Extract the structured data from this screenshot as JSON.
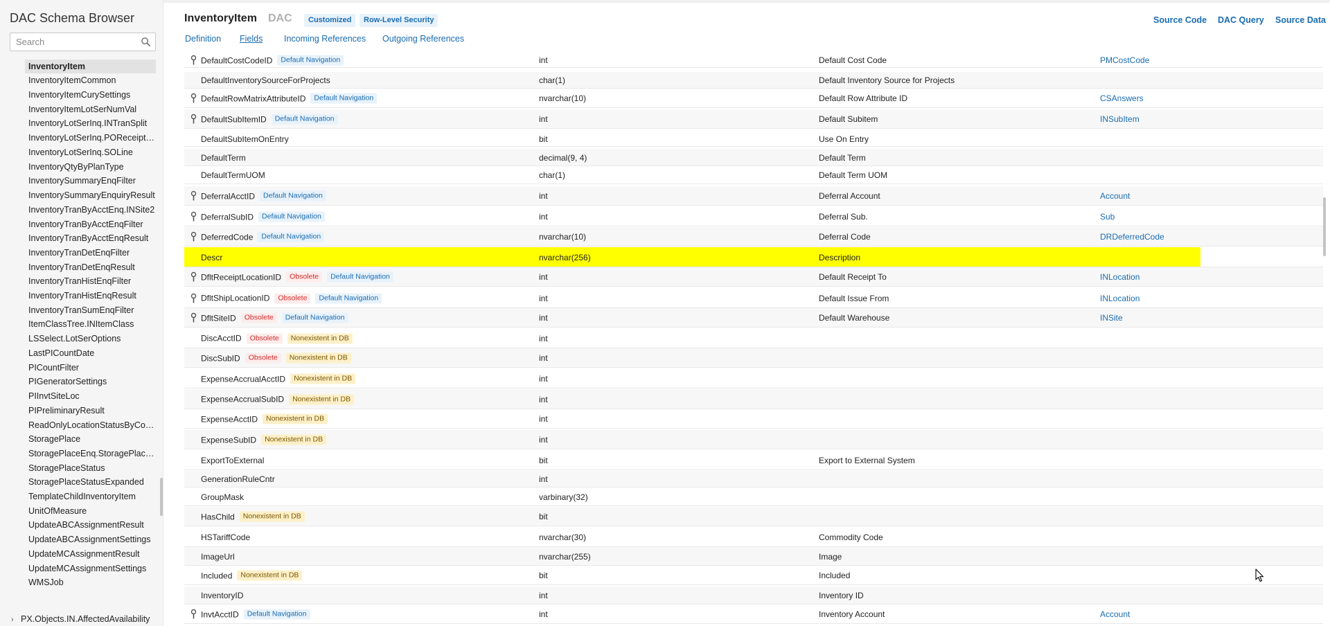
{
  "sidebar": {
    "title": "DAC Schema Browser",
    "search_placeholder": "Search",
    "items": [
      "InventoryItem",
      "InventoryItemCommon",
      "InventoryItemCurySettings",
      "InventoryItemLotSerNumVal",
      "InventoryLotSerInq.INTranSplit",
      "InventoryLotSerInq.POReceiptLine",
      "InventoryLotSerInq.SOLine",
      "InventoryQtyByPlanType",
      "InventorySummaryEnqFilter",
      "InventorySummaryEnquiryResult",
      "InventoryTranByAcctEnq.INSite2",
      "InventoryTranByAcctEnqFilter",
      "InventoryTranByAcctEnqResult",
      "InventoryTranDetEnqFilter",
      "InventoryTranDetEnqResult",
      "InventoryTranHistEnqFilter",
      "InventoryTranHistEnqResult",
      "InventoryTranSumEnqFilter",
      "ItemClassTree.INItemClass",
      "LSSelect.LotSerOptions",
      "LastPICountDate",
      "PICountFilter",
      "PIGeneratorSettings",
      "PIInvtSiteLoc",
      "PIPreliminaryResult",
      "ReadOnlyLocationStatusByCost...",
      "StoragePlace",
      "StoragePlaceEnq.StoragePlaceF...",
      "StoragePlaceStatus",
      "StoragePlaceStatusExpanded",
      "TemplateChildInventoryItem",
      "UnitOfMeasure",
      "UpdateABCAssignmentResult",
      "UpdateABCAssignmentSettings",
      "UpdateMCAssignmentResult",
      "UpdateMCAssignmentSettings",
      "WMSJob"
    ],
    "selected_index": 0,
    "group_label": "PX.Objects.IN.AffectedAvailability"
  },
  "header": {
    "title": "InventoryItem",
    "kind": "DAC",
    "badges": [
      "Customized",
      "Row-Level Security"
    ],
    "links": [
      "Source Code",
      "DAC Query",
      "Source Data"
    ],
    "tabs": [
      "Definition",
      "Fields",
      "Incoming References",
      "Outgoing References"
    ],
    "active_tab": "Fields"
  },
  "badge_labels": {
    "nav": "Default Navigation",
    "obs": "Obsolete",
    "nex": "Nonexistent in DB"
  },
  "fields": [
    {
      "name": "DefaultCostCodeID",
      "key": true,
      "badges": [
        "nav"
      ],
      "type": "int",
      "display": "Default Cost Code",
      "ref": "PMCostCode"
    },
    {
      "name": "DefaultInventorySourceForProjects",
      "key": false,
      "badges": [],
      "type": "char(1)",
      "display": "Default Inventory Source for Projects",
      "ref": ""
    },
    {
      "name": "DefaultRowMatrixAttributeID",
      "key": true,
      "badges": [
        "nav"
      ],
      "type": "nvarchar(10)",
      "display": "Default Row Attribute ID",
      "ref": "CSAnswers"
    },
    {
      "name": "DefaultSubItemID",
      "key": true,
      "badges": [
        "nav"
      ],
      "type": "int",
      "display": "Default Subitem",
      "ref": "INSubItem"
    },
    {
      "name": "DefaultSubItemOnEntry",
      "key": false,
      "badges": [],
      "type": "bit",
      "display": "Use On Entry",
      "ref": ""
    },
    {
      "name": "DefaultTerm",
      "key": false,
      "badges": [],
      "type": "decimal(9, 4)",
      "display": "Default Term",
      "ref": ""
    },
    {
      "name": "DefaultTermUOM",
      "key": false,
      "badges": [],
      "type": "char(1)",
      "display": "Default Term UOM",
      "ref": ""
    },
    {
      "name": "DeferralAcctID",
      "key": true,
      "badges": [
        "nav"
      ],
      "type": "int",
      "display": "Deferral Account",
      "ref": "Account"
    },
    {
      "name": "DeferralSubID",
      "key": true,
      "badges": [
        "nav"
      ],
      "type": "int",
      "display": "Deferral Sub.",
      "ref": "Sub"
    },
    {
      "name": "DeferredCode",
      "key": true,
      "badges": [
        "nav"
      ],
      "type": "nvarchar(10)",
      "display": "Deferral Code",
      "ref": "DRDeferredCode"
    },
    {
      "name": "Descr",
      "key": false,
      "badges": [],
      "type": "nvarchar(256)",
      "display": "Description",
      "ref": "",
      "highlight": true
    },
    {
      "name": "DfltReceiptLocationID",
      "key": true,
      "badges": [
        "obs",
        "nav"
      ],
      "type": "int",
      "display": "Default Receipt To",
      "ref": "INLocation"
    },
    {
      "name": "DfltShipLocationID",
      "key": true,
      "badges": [
        "obs",
        "nav"
      ],
      "type": "int",
      "display": "Default Issue From",
      "ref": "INLocation"
    },
    {
      "name": "DfltSiteID",
      "key": true,
      "badges": [
        "obs",
        "nav"
      ],
      "type": "int",
      "display": "Default Warehouse",
      "ref": "INSite"
    },
    {
      "name": "DiscAcctID",
      "key": false,
      "badges": [
        "obs",
        "nex"
      ],
      "type": "int",
      "display": "",
      "ref": ""
    },
    {
      "name": "DiscSubID",
      "key": false,
      "badges": [
        "obs",
        "nex"
      ],
      "type": "int",
      "display": "",
      "ref": ""
    },
    {
      "name": "ExpenseAccrualAcctID",
      "key": false,
      "badges": [
        "nex"
      ],
      "type": "int",
      "display": "",
      "ref": ""
    },
    {
      "name": "ExpenseAccrualSubID",
      "key": false,
      "badges": [
        "nex"
      ],
      "type": "int",
      "display": "",
      "ref": ""
    },
    {
      "name": "ExpenseAcctID",
      "key": false,
      "badges": [
        "nex"
      ],
      "type": "int",
      "display": "",
      "ref": ""
    },
    {
      "name": "ExpenseSubID",
      "key": false,
      "badges": [
        "nex"
      ],
      "type": "int",
      "display": "",
      "ref": ""
    },
    {
      "name": "ExportToExternal",
      "key": false,
      "badges": [],
      "type": "bit",
      "display": "Export to External System",
      "ref": ""
    },
    {
      "name": "GenerationRuleCntr",
      "key": false,
      "badges": [],
      "type": "int",
      "display": "",
      "ref": ""
    },
    {
      "name": "GroupMask",
      "key": false,
      "badges": [],
      "type": "varbinary(32)",
      "display": "",
      "ref": ""
    },
    {
      "name": "HasChild",
      "key": false,
      "badges": [
        "nex"
      ],
      "type": "bit",
      "display": "",
      "ref": ""
    },
    {
      "name": "HSTariffCode",
      "key": false,
      "badges": [],
      "type": "nvarchar(30)",
      "display": "Commodity Code",
      "ref": ""
    },
    {
      "name": "ImageUrl",
      "key": false,
      "badges": [],
      "type": "nvarchar(255)",
      "display": "Image",
      "ref": ""
    },
    {
      "name": "Included",
      "key": false,
      "badges": [
        "nex"
      ],
      "type": "bit",
      "display": "Included",
      "ref": ""
    },
    {
      "name": "InventoryID",
      "key": false,
      "badges": [],
      "type": "int",
      "display": "Inventory ID",
      "ref": ""
    },
    {
      "name": "InvtAcctID",
      "key": true,
      "badges": [
        "nav"
      ],
      "type": "int",
      "display": "Inventory Account",
      "ref": "Account"
    }
  ]
}
